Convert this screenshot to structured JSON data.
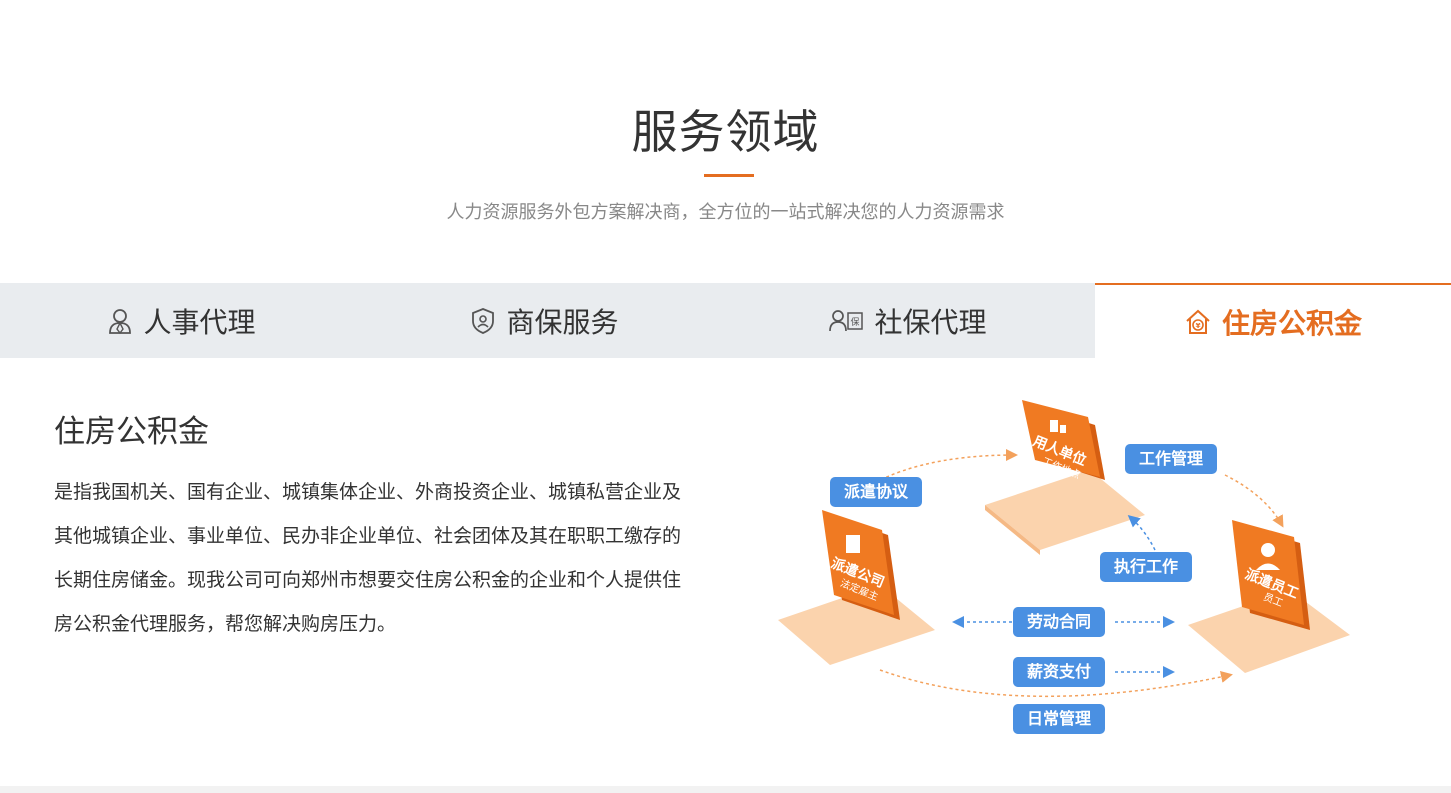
{
  "section": {
    "title": "服务领域",
    "subtitle": "人力资源服务外包方案解决商，全方位的一站式解决您的人力资源需求"
  },
  "tabs": [
    {
      "label": "人事代理",
      "icon": "person-icon",
      "active": false
    },
    {
      "label": "商保服务",
      "icon": "shield-icon",
      "active": false
    },
    {
      "label": "社保代理",
      "icon": "social-insurance-icon",
      "active": false
    },
    {
      "label": "住房公积金",
      "icon": "house-fund-icon",
      "active": true
    }
  ],
  "content": {
    "heading": "住房公积金",
    "description": "是指我国机关、国有企业、城镇集体企业、外商投资企业、城镇私营企业及其他城镇企业、事业单位、民办非企业单位、社会团体及其在职职工缴存的长期住房储金。现我公司可向郑州市想要交住房公积金的企业和个人提供住房公积金代理服务，帮您解决购房压力。"
  },
  "diagram": {
    "nodes": {
      "employer": {
        "title": "用人单位",
        "sub": "工作地点"
      },
      "agency": {
        "title": "派遣公司",
        "sub": "法定雇主"
      },
      "employee": {
        "title": "派遣员工",
        "sub": "员工"
      }
    },
    "labels": {
      "dispatch_agreement": "派遣协议",
      "work_management": "工作管理",
      "execute_work": "执行工作",
      "labor_contract": "劳动合同",
      "salary_payment": "薪资支付",
      "daily_management": "日常管理"
    }
  },
  "colors": {
    "accent": "#e46d20",
    "tab_bg": "#e9ecef",
    "pill_blue": "#4a90e2",
    "node_orange": "#f07a22",
    "node_base": "#fbd3ad"
  }
}
